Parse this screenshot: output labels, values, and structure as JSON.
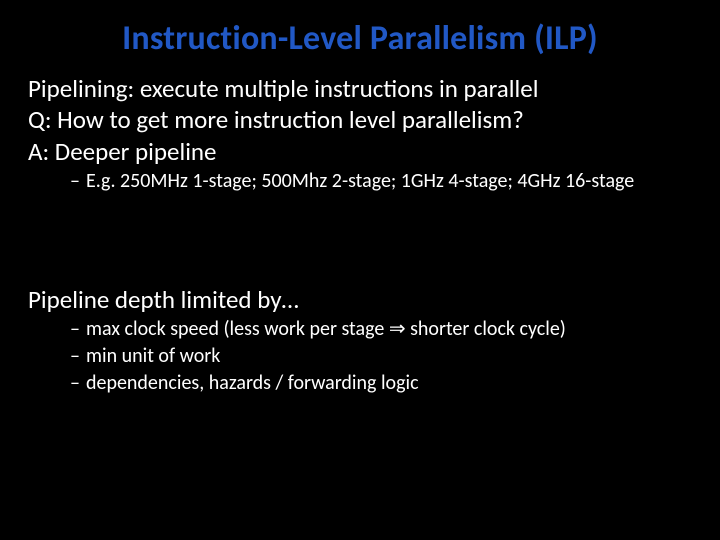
{
  "title": "Instruction-Level Parallelism (ILP)",
  "lines": {
    "l1": "Pipelining: execute multiple instructions in parallel",
    "l2": "Q: How to get more instruction level parallelism?",
    "l3": "A: Deeper pipeline"
  },
  "sub1": {
    "s1": "E.g. 250MHz 1-stage; 500Mhz 2-stage; 1GHz 4-stage; 4GHz 16-stage"
  },
  "line4": "Pipeline depth limited by…",
  "sub2": {
    "s1_a": "max clock speed (less work per stage ",
    "s1_b": " shorter clock cycle)",
    "s2": "min unit of work",
    "s3": "dependencies, hazards / forwarding logic"
  },
  "glyphs": {
    "implies": "⇒"
  }
}
